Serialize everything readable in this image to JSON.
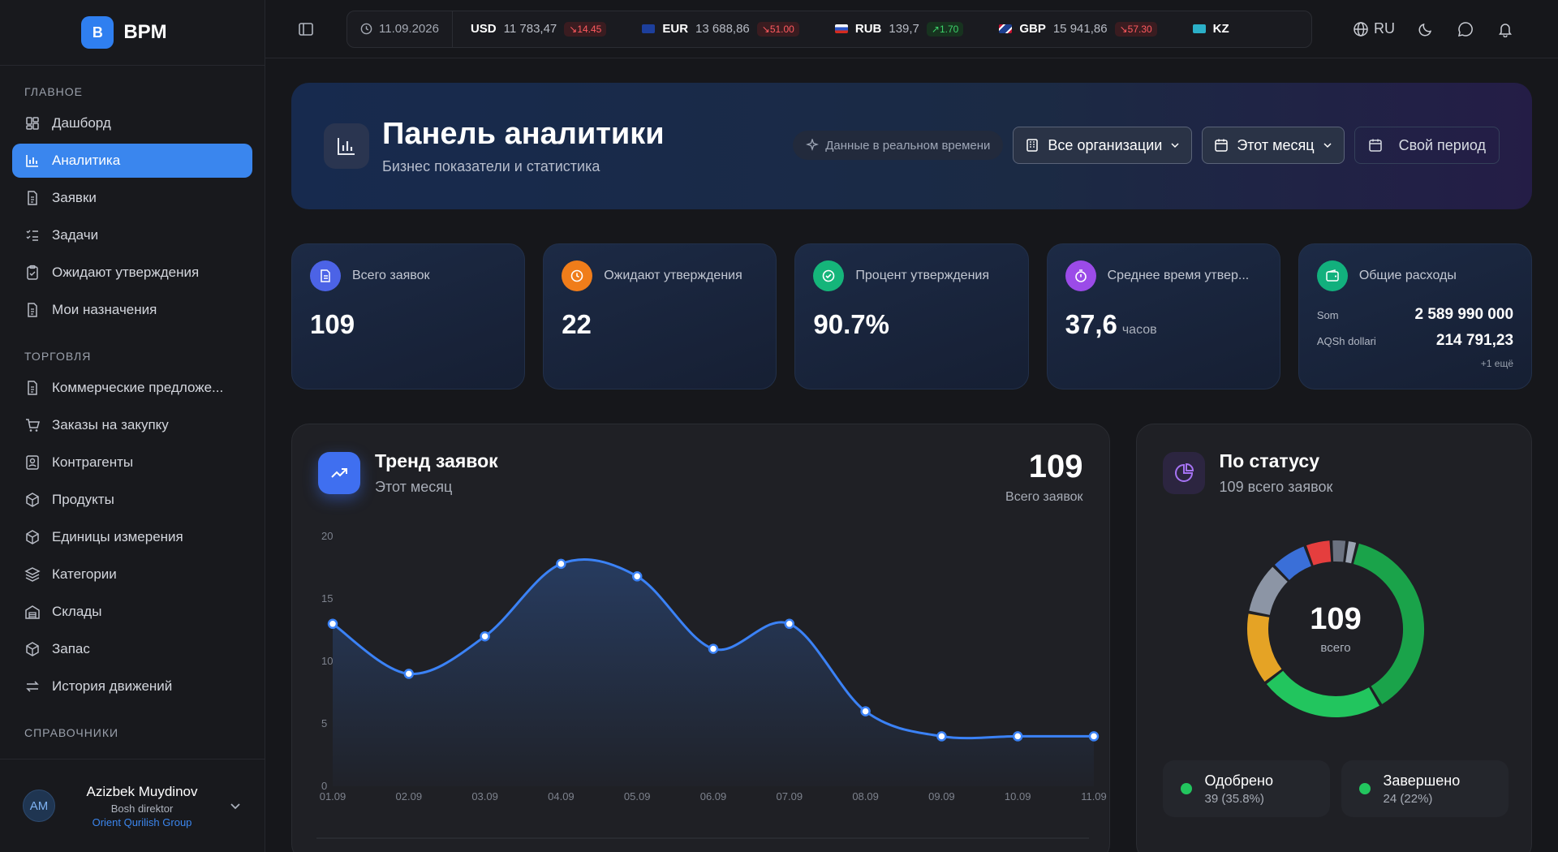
{
  "brand": {
    "badge": "B",
    "name": "BPM"
  },
  "sidebar": {
    "sections": [
      {
        "title": "ГЛАВНОЕ",
        "items": [
          {
            "label": "Дашборд",
            "icon": "dashboard-icon"
          },
          {
            "label": "Аналитика",
            "icon": "chart-icon",
            "active": true
          },
          {
            "label": "Заявки",
            "icon": "document-icon"
          },
          {
            "label": "Задачи",
            "icon": "list-icon"
          },
          {
            "label": "Ожидают утверждения",
            "icon": "clipboard-icon"
          },
          {
            "label": "Мои назначения",
            "icon": "document-icon"
          }
        ]
      },
      {
        "title": "ТОРГОВЛЯ",
        "items": [
          {
            "label": "Коммерческие предложе...",
            "icon": "document-icon"
          },
          {
            "label": "Заказы на закупку",
            "icon": "cart-icon"
          },
          {
            "label": "Контрагенты",
            "icon": "contact-icon"
          },
          {
            "label": "Продукты",
            "icon": "box-icon"
          },
          {
            "label": "Единицы измерения",
            "icon": "box-icon"
          },
          {
            "label": "Категории",
            "icon": "layers-icon"
          },
          {
            "label": "Склады",
            "icon": "warehouse-icon"
          },
          {
            "label": "Запас",
            "icon": "box-icon"
          },
          {
            "label": "История движений",
            "icon": "arrows-icon"
          }
        ]
      },
      {
        "title": "СПРАВОЧНИКИ",
        "items": []
      }
    ]
  },
  "user": {
    "initials": "AM",
    "name": "Azizbek Muydinov",
    "role": "Bosh direktor",
    "org": "Orient Qurilish Group"
  },
  "topbar": {
    "date": "11.09.2026",
    "rates": [
      {
        "code": "USD",
        "value": "11 783,47",
        "change": "14.45",
        "dir": "down"
      },
      {
        "code": "EUR",
        "value": "13 688,86",
        "change": "51.00",
        "dir": "down"
      },
      {
        "code": "RUB",
        "value": "139,7",
        "change": "1.70",
        "dir": "up"
      },
      {
        "code": "GBP",
        "value": "15 941,86",
        "change": "57.30",
        "dir": "down"
      },
      {
        "code": "KZ",
        "value": "",
        "change": "",
        "dir": ""
      }
    ],
    "lang": "RU"
  },
  "hero": {
    "title": "Панель аналитики",
    "subtitle": "Бизнес показатели и статистика",
    "live": "Данные в реальном времени",
    "org_select": "Все организации",
    "period_select": "Этот месяц",
    "custom_period": "Свой период"
  },
  "kpis": {
    "total": {
      "label": "Всего заявок",
      "value": "109"
    },
    "pending": {
      "label": "Ожидают утверждения",
      "value": "22"
    },
    "rate": {
      "label": "Процент утверждения",
      "value": "90.7%"
    },
    "avg": {
      "label": "Среднее время утвер...",
      "value": "37,6",
      "unit": "часов"
    },
    "expenses": {
      "label": "Общие расходы",
      "rows": [
        {
          "currency": "Som",
          "amount": "2 589 990 000"
        },
        {
          "currency": "AQSh dollari",
          "amount": "214 791,23"
        }
      ],
      "more": "+1 ещё"
    }
  },
  "trend": {
    "title": "Тренд заявок",
    "subtitle": "Этот месяц",
    "total": "109",
    "total_label": "Всего заявок"
  },
  "status": {
    "title": "По статусу",
    "subtitle": "109 всего заявок",
    "center_value": "109",
    "center_label": "всего",
    "legend": [
      {
        "name": "Одобрено",
        "value": "39 (35.8%)",
        "color": "#22c55e"
      },
      {
        "name": "Завершено",
        "value": "24 (22%)",
        "color": "#22c55e"
      }
    ]
  },
  "chart_data": [
    {
      "type": "area",
      "categories": [
        "01.09",
        "02.09",
        "03.09",
        "04.09",
        "05.09",
        "06.09",
        "07.09",
        "08.09",
        "09.09",
        "10.09",
        "11.09"
      ],
      "values": [
        13,
        9,
        12,
        17.8,
        16.8,
        11,
        13,
        6,
        4,
        4,
        4
      ],
      "ylim": [
        0,
        20
      ],
      "yticks": [
        0,
        5,
        10,
        15,
        20
      ],
      "color": "#3b82f6"
    },
    {
      "type": "pie",
      "labels": [
        "Одобрено",
        "Завершено"
      ],
      "values": [
        39,
        24,
        14,
        10,
        7,
        5,
        3,
        2
      ],
      "colors": [
        "#1aa34a",
        "#22c55e",
        "#e5a325",
        "#8c95a5",
        "#3a6fd8",
        "#e53e3e",
        "#6b7280",
        "#9aa3b2"
      ]
    }
  ]
}
